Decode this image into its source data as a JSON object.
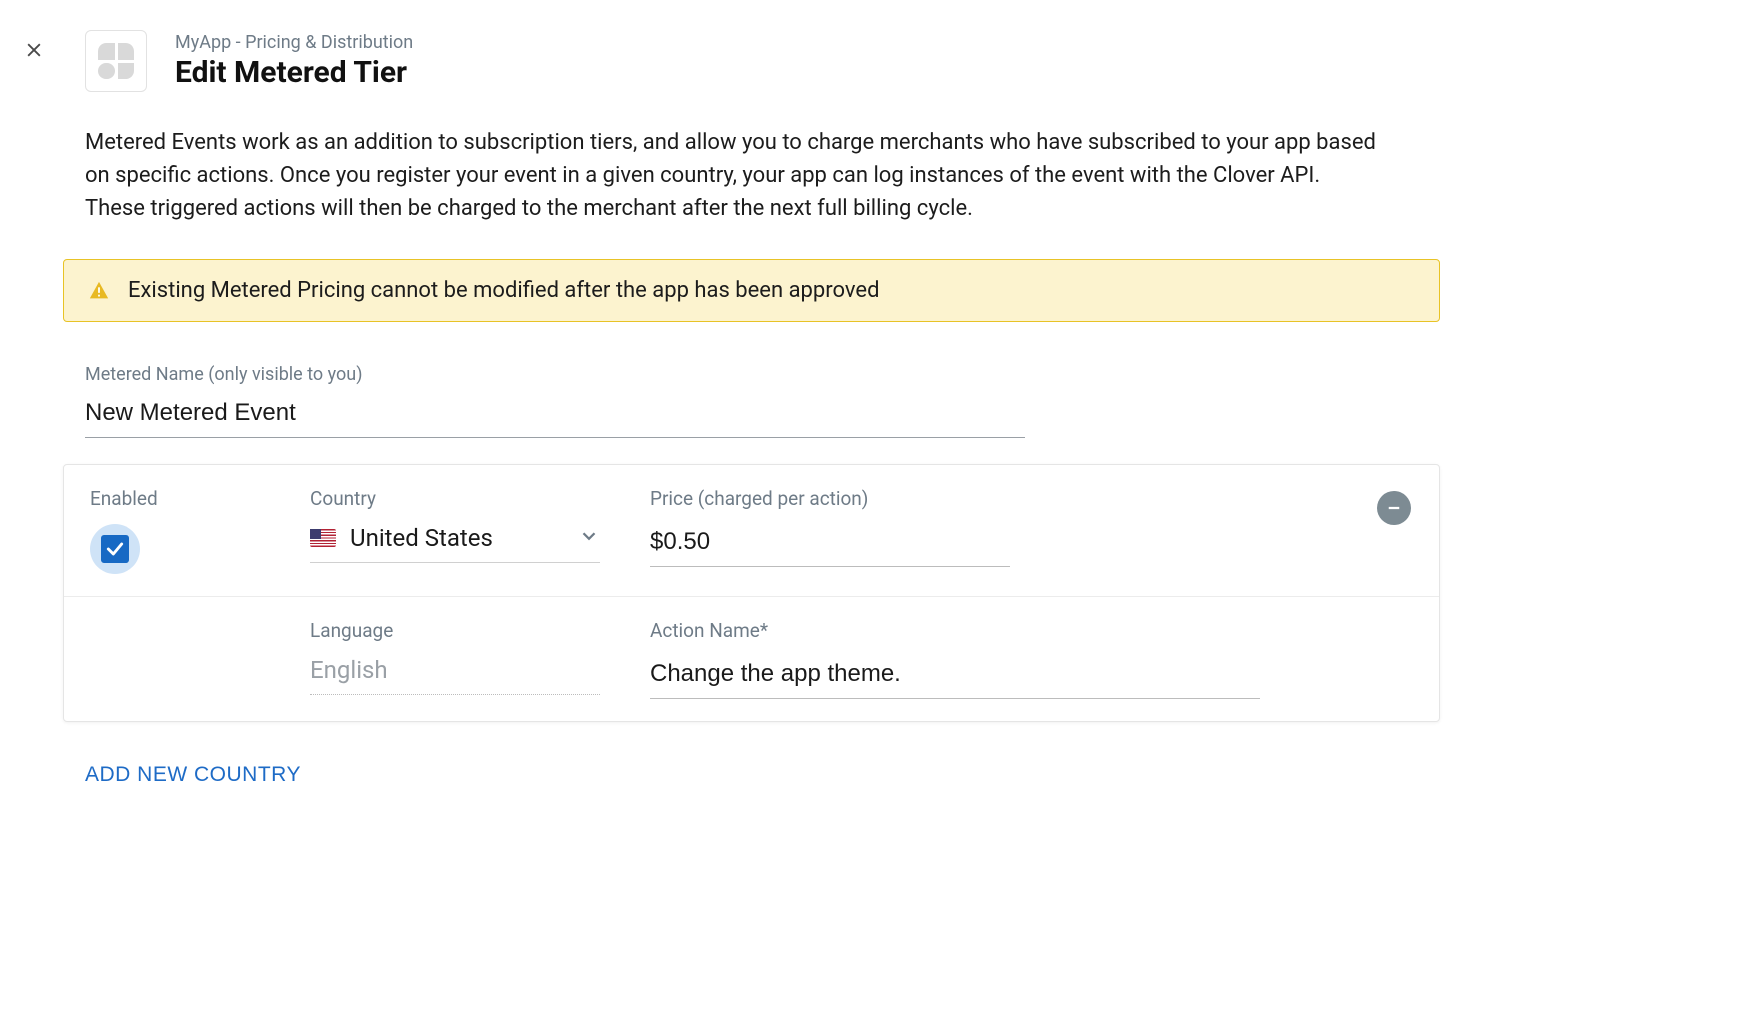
{
  "header": {
    "breadcrumb": "MyApp - Pricing & Distribution",
    "title": "Edit Metered Tier"
  },
  "description": "Metered Events work as an addition to subscription tiers, and allow you to charge merchants who have subscribed to your app based on specific actions. Once you register your event in a given country, your app can log instances of the event with the Clover API. These triggered actions will then be charged to the merchant after the next full billing cycle.",
  "warning": {
    "text": "Existing Metered Pricing cannot be modified after the app has been approved"
  },
  "form": {
    "metered_name_label": "Metered Name (only visible to you)",
    "metered_name_value": "New Metered Event"
  },
  "country_row": {
    "enabled_label": "Enabled",
    "enabled_value": true,
    "country_label": "Country",
    "country_value": "United States",
    "price_label": "Price (charged per action)",
    "price_value": "$0.50",
    "language_label": "Language",
    "language_value": "English",
    "action_name_label": "Action Name*",
    "action_name_value": "Change the app theme."
  },
  "actions": {
    "add_country_label": "ADD NEW COUNTRY"
  }
}
